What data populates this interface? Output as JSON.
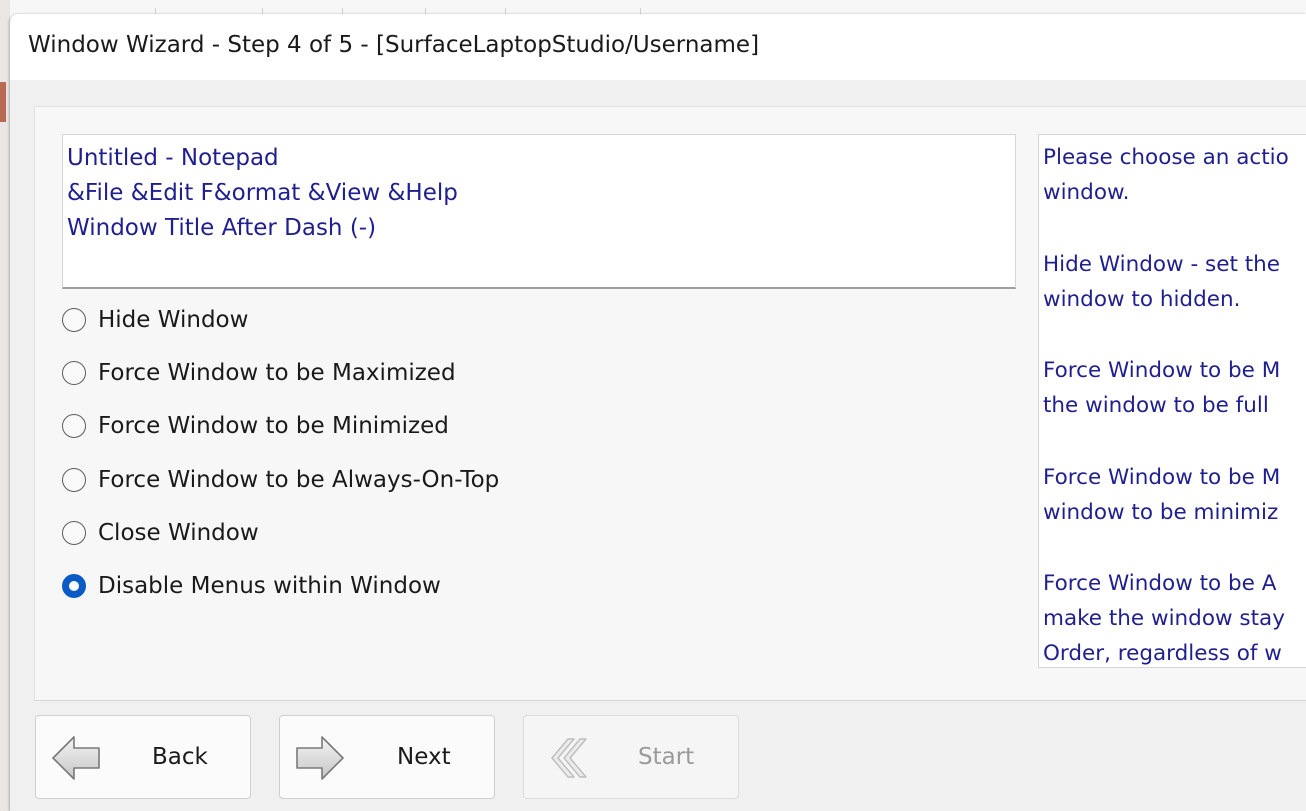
{
  "window": {
    "title": "Window Wizard - Step 4 of 5 - [SurfaceLaptopStudio/Username]"
  },
  "target_info": {
    "lines": [
      "Untitled - Notepad",
      "&File &Edit F&ormat &View &Help",
      "Window Title After Dash (-)"
    ]
  },
  "actions": {
    "selected_index": 5,
    "options": [
      {
        "label": "Hide Window",
        "checked": false
      },
      {
        "label": "Force Window to be Maximized",
        "checked": false
      },
      {
        "label": "Force Window to be Minimized",
        "checked": false
      },
      {
        "label": "Force Window to be Always-On-Top",
        "checked": false
      },
      {
        "label": "Close Window",
        "checked": false
      },
      {
        "label": "Disable Menus within Window",
        "checked": true
      }
    ]
  },
  "help_text": {
    "lines": [
      "Please choose an actio",
      "window.",
      "Hide Window - set the",
      "window to hidden.",
      "Force Window to be M",
      "the window to be full",
      "Force Window to be M",
      "window to be minimiz",
      "Force Window to be A",
      "make the window stay",
      "Order, regardless of w"
    ]
  },
  "nav": {
    "back_label": "Back",
    "next_label": "Next",
    "start_label": "Start",
    "start_enabled": false
  },
  "icons": {
    "back": "back-arrow-icon",
    "next": "next-arrow-icon",
    "start": "double-chevron-left-icon"
  },
  "colors": {
    "text_blue": "#1f1f8f",
    "radio_selected": "#0a5bc4",
    "panel_bg": "#f0f0f0"
  }
}
